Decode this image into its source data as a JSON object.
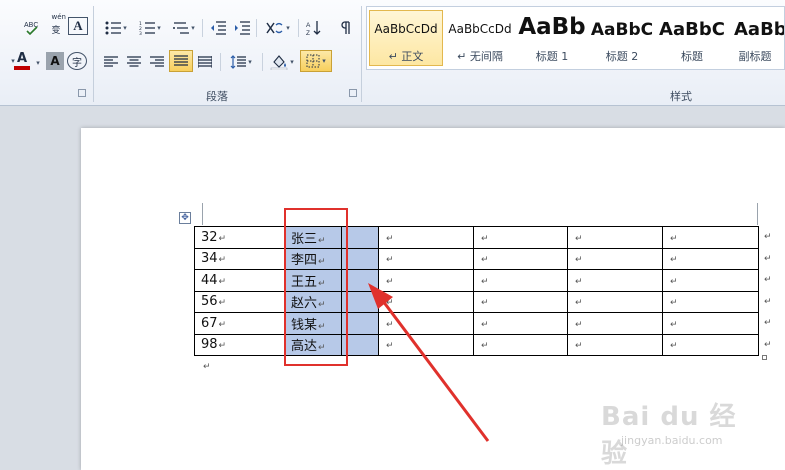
{
  "ribbon": {
    "paragraph_group_label": "段落",
    "styles_group_label": "样式",
    "font_tools": {
      "phonetic": "A",
      "phonetic_sup": "wén",
      "char_border": "A",
      "font_color": "A",
      "char_shading": "A",
      "enclose": "字"
    },
    "styles": [
      {
        "preview": "AaBbCcDd",
        "name": "↵ 正文",
        "selected": true
      },
      {
        "preview": "AaBbCcDd",
        "name": "↵ 无间隔",
        "selected": false
      },
      {
        "preview": "AaBb",
        "name": "标题 1",
        "selected": false
      },
      {
        "preview": "AaBbC",
        "name": "标题 2",
        "selected": false
      },
      {
        "preview": "AaBbC",
        "name": "标题",
        "selected": false
      },
      {
        "preview": "AaBb",
        "name": "副标题",
        "selected": false
      }
    ]
  },
  "document": {
    "paragraph_mark": "↵",
    "rows": [
      {
        "num": "32",
        "name": "张三"
      },
      {
        "num": "34",
        "name": "李四"
      },
      {
        "num": "44",
        "name": "王五"
      },
      {
        "num": "56",
        "name": "赵六"
      },
      {
        "num": "67",
        "name": "钱某"
      },
      {
        "num": "98",
        "name": "高达"
      }
    ]
  },
  "watermark": {
    "text": "Bai du 经验",
    "sub": "jingyan.baidu.com"
  },
  "colors": {
    "selection": "#b7c9e8",
    "annotation": "#e0312c",
    "font_color_bar": "#c00000"
  }
}
